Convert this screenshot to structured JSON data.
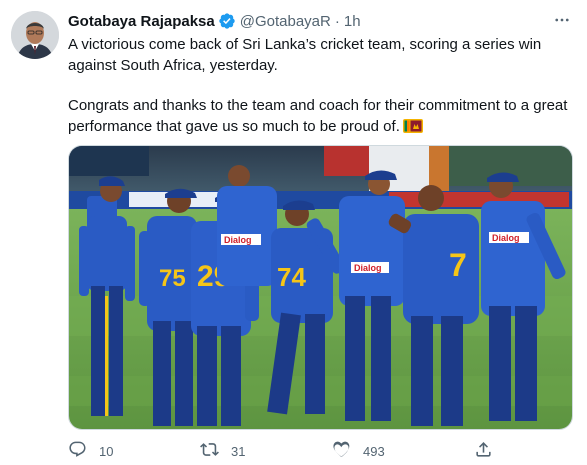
{
  "author": {
    "display_name": "Gotabaya Rajapaksa",
    "handle": "@GotabayaR",
    "separator": "·",
    "time": "1h"
  },
  "tweet": {
    "paragraph1": "A victorious come back of Sri Lanka’s cricket team, scoring a series win against South Africa, yesterday.",
    "paragraph2": "Congrats and thanks to the team and coach for their commitment to a great performance that gave us so much to be proud of."
  },
  "media": {
    "jersey_numbers": [
      "75",
      "29",
      "74",
      "7"
    ],
    "sponsor": "Dialog"
  },
  "actions": {
    "replies": "10",
    "retweets": "31",
    "likes": "493"
  },
  "colors": {
    "accent": "#1d9bf0",
    "secondary_text": "#536471",
    "jersey_blue": "#2a5bc4",
    "jersey_yellow": "#f5c518",
    "pitch_green": "#6ba34a"
  },
  "icons": [
    "verified-badge-icon",
    "more-icon",
    "sri-lanka-flag-icon",
    "reply-icon",
    "retweet-icon",
    "like-icon",
    "share-icon"
  ]
}
